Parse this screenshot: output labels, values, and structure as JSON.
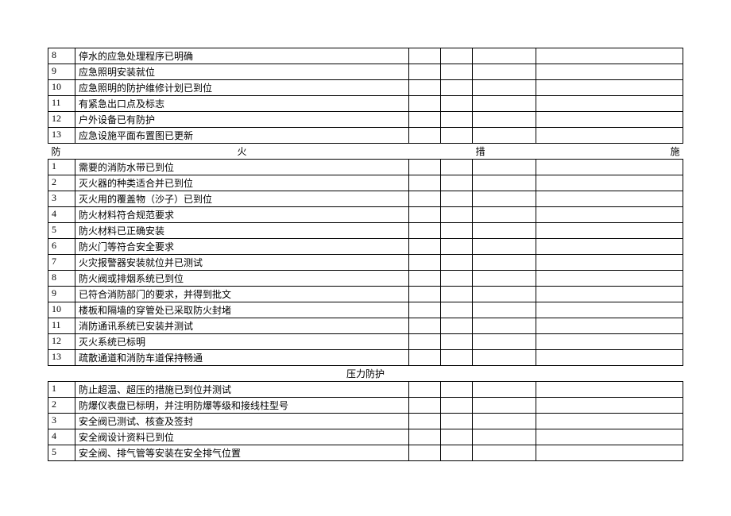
{
  "section1": {
    "rows": [
      {
        "n": "8",
        "t": "停水的应急处理程序已明确"
      },
      {
        "n": "9",
        "t": "应急照明安装就位"
      },
      {
        "n": "10",
        "t": "应急照明的防护维修计划已到位"
      },
      {
        "n": "11",
        "t": "有紧急出口点及标志"
      },
      {
        "n": "12",
        "t": "户外设备已有防护"
      },
      {
        "n": "13",
        "t": "应急设施平面布置图已更新"
      }
    ]
  },
  "header2": {
    "c1": "防",
    "c2": "火",
    "c3": "措",
    "c4": "施"
  },
  "section2": {
    "rows": [
      {
        "n": "1",
        "t": "需要的消防水带已到位"
      },
      {
        "n": "2",
        "t": "灭火器的种类适合并已到位"
      },
      {
        "n": "3",
        "t": "灭火用的覆盖物（沙子）已到位"
      },
      {
        "n": "4",
        "t": "防火材料符合规范要求"
      },
      {
        "n": "5",
        "t": "防火材料已正确安装"
      },
      {
        "n": "6",
        "t": "防火门等符合安全要求"
      },
      {
        "n": "7",
        "t": "火灾报警器安装就位并已测试"
      },
      {
        "n": "8",
        "t": "防火阀或排烟系统已到位"
      },
      {
        "n": "9",
        "t": "已符合消防部门的要求，并得到批文"
      },
      {
        "n": "10",
        "t": "楼板和隔墙的穿管处已采取防火封堵"
      },
      {
        "n": "11",
        "t": "消防通讯系统已安装并测试"
      },
      {
        "n": "12",
        "t": "灭火系统已标明"
      },
      {
        "n": "13",
        "t": "疏散通道和消防车道保持畅通"
      }
    ]
  },
  "header3": "压力防护",
  "section3": {
    "rows": [
      {
        "n": "1",
        "t": "防止超温、超压的措施已到位并测试"
      },
      {
        "n": "2",
        "t": "防爆仪表盘已标明，并注明防爆等级和接线柱型号"
      },
      {
        "n": "3",
        "t": "安全阀已测试、核查及签封"
      },
      {
        "n": "4",
        "t": "安全阀设计资料已到位"
      },
      {
        "n": "5",
        "t": "安全阀、排气管等安装在安全排气位置"
      }
    ]
  }
}
